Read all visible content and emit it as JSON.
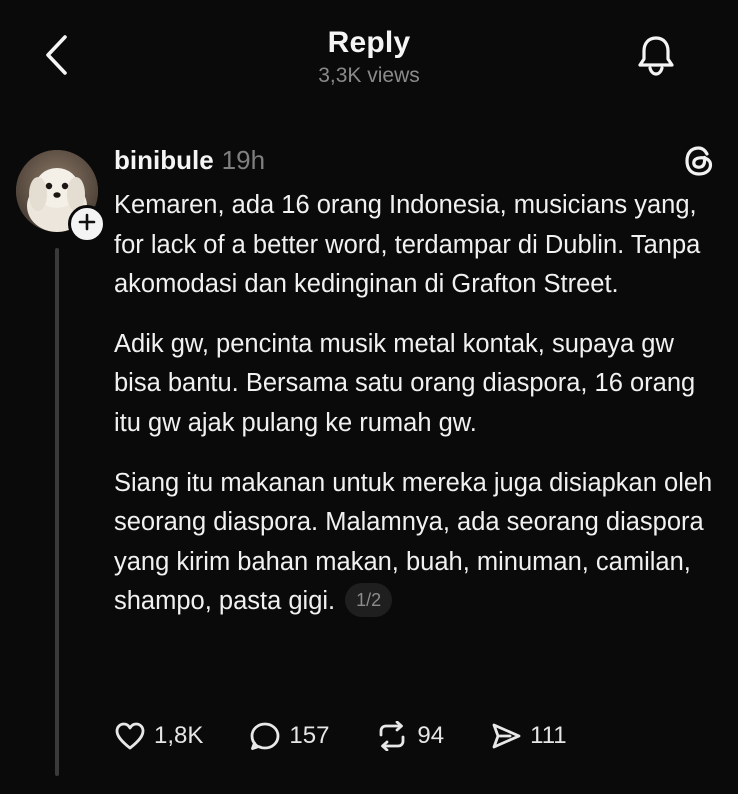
{
  "header": {
    "title": "Reply",
    "views": "3,3K views"
  },
  "post": {
    "username": "binibule",
    "timestamp": "19h",
    "paragraphs": [
      "Kemaren, ada 16 orang Indonesia, musicians yang, for lack of a better word, terdampar di Dublin. Tanpa akomodasi dan kedinginan di Grafton Street.",
      "Adik gw, pencinta musik metal kontak, supaya gw bisa bantu. Bersama satu orang diaspora, 16 orang itu gw ajak pulang ke rumah gw.",
      "Siang itu makanan untuk mereka juga disiapkan oleh seorang diaspora. Malamnya, ada seorang diaspora yang kirim bahan makan, buah, minuman, camilan, shampo, pasta gigi."
    ],
    "page_indicator": "1/2",
    "stats": {
      "likes": "1,8K",
      "comments": "157",
      "reposts": "94",
      "shares": "111"
    }
  },
  "icons": {
    "back": "chevron-left-icon",
    "bell": "bell-icon",
    "follow": "plus-icon",
    "threads": "threads-logo-icon",
    "like": "heart-icon",
    "comment": "comment-bubble-icon",
    "repost": "repost-icon",
    "share": "send-icon"
  },
  "colors": {
    "background": "#0a0a0a",
    "text": "#f3f3f3",
    "muted": "#8a8a8a"
  }
}
